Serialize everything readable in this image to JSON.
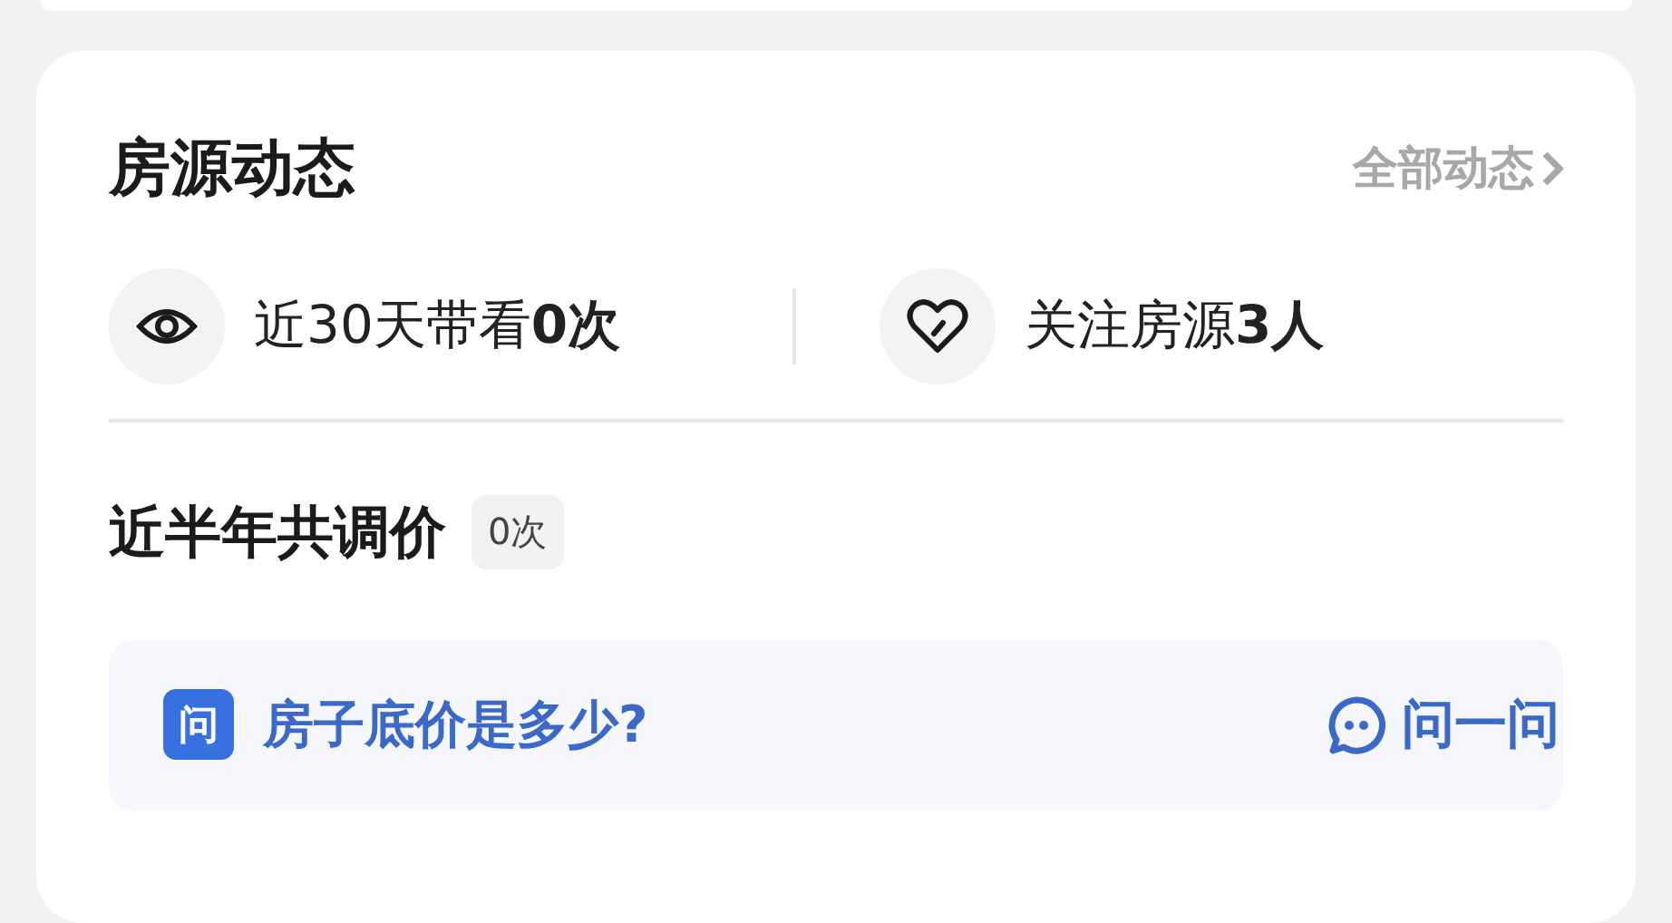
{
  "section": {
    "title": "房源动态",
    "more_link": "全部动态"
  },
  "stats": [
    {
      "kind": "views",
      "text": "近30天带看**0次**"
    },
    {
      "kind": "followers",
      "text": "关注房源**3人**"
    }
  ],
  "price_adjust": {
    "title": "近半年共调价",
    "badge": "0次"
  },
  "question": {
    "icon_label": "问",
    "text": "房子底价是多少?",
    "action": "问一问"
  }
}
